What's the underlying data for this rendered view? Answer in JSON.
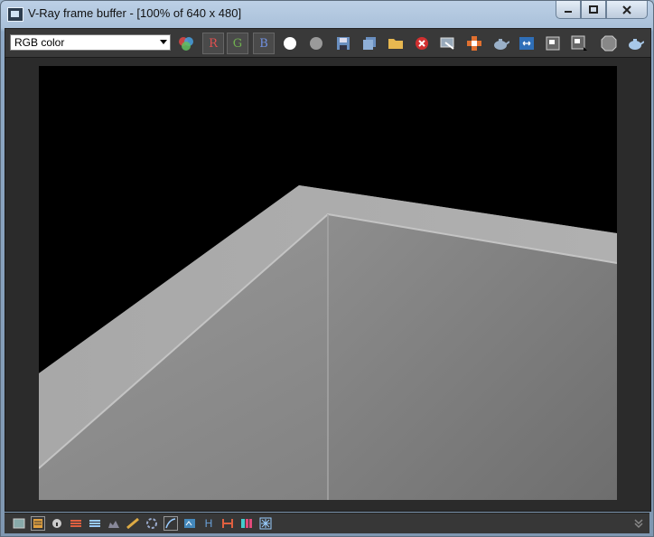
{
  "window": {
    "title": "V-Ray frame buffer - [100% of 640 x 480]"
  },
  "toolbar": {
    "channel_select": "RGB color",
    "r_label": "R",
    "g_label": "G",
    "b_label": "B"
  },
  "colors": {
    "toolbar_bg": "#393939",
    "viewport_bg": "#2b2b2b",
    "chan_r": "#e05050",
    "chan_g": "#70b050",
    "chan_b": "#7090e0"
  },
  "statusbar": {
    "icons": [
      "display-icon",
      "tracker-icon",
      "info-icon",
      "levels-icon",
      "corrections-icon",
      "histogram-icon",
      "pixel-aspect-icon",
      "lens-effects-icon",
      "curve-icon",
      "exposure-icon",
      "h-icon",
      "compare-icon",
      "color-balance-icon",
      "lut-icon"
    ]
  },
  "labels": {
    "h": "H"
  }
}
